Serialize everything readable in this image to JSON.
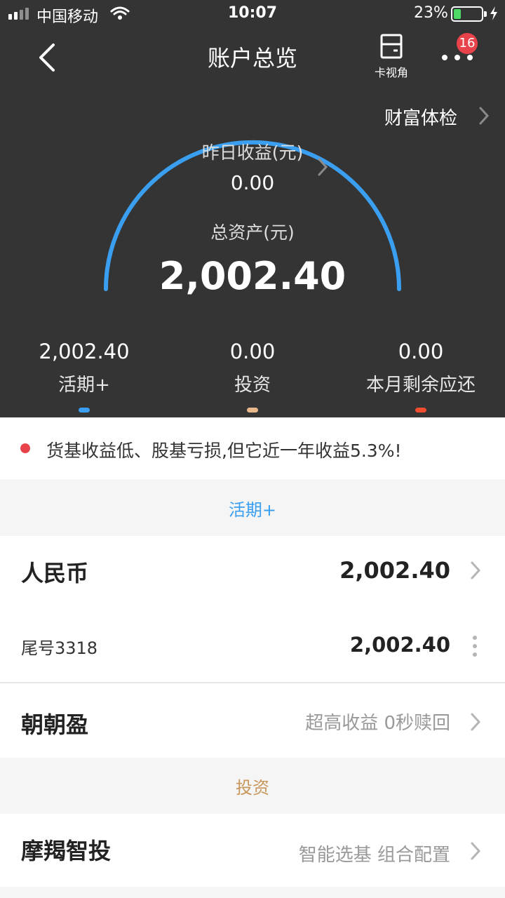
{
  "status_bar": {
    "carrier": "中国移动",
    "time": "10:07",
    "battery": "23%"
  },
  "nav": {
    "title": "账户总览",
    "card_view_label": "卡视角",
    "badge_count": "16"
  },
  "header": {
    "wealth_check": "财富体检",
    "yesterday_label": "昨日收益(元)",
    "yesterday_value": "0.00",
    "total_label": "总资产(元)",
    "total_value": "2,002.40",
    "gauge_color": "#3a9ff0"
  },
  "stats": [
    {
      "value": "2,002.40",
      "label": "活期+",
      "color": "#3a9ff0"
    },
    {
      "value": "0.00",
      "label": "投资",
      "color": "#e8b88a"
    },
    {
      "value": "0.00",
      "label": "本月剩余应还",
      "color": "#f04d2e"
    }
  ],
  "notice": {
    "text": "货基收益低、股基亏损,但它近一年收益5.3%!"
  },
  "sections": {
    "current": {
      "label": "活期+",
      "color": "#3a9ff0",
      "rmb_title": "人民币",
      "rmb_value": "2,002.40",
      "tail_label": "尾号3318",
      "tail_value": "2,002.40",
      "zhaozhao_title": "朝朝盈",
      "zhaozhao_desc": "超高收益 0秒赎回"
    },
    "invest": {
      "label": "投资",
      "color": "#c8965a",
      "moxie_title": "摩羯智投",
      "moxie_desc": "智能选基 组合配置"
    }
  }
}
